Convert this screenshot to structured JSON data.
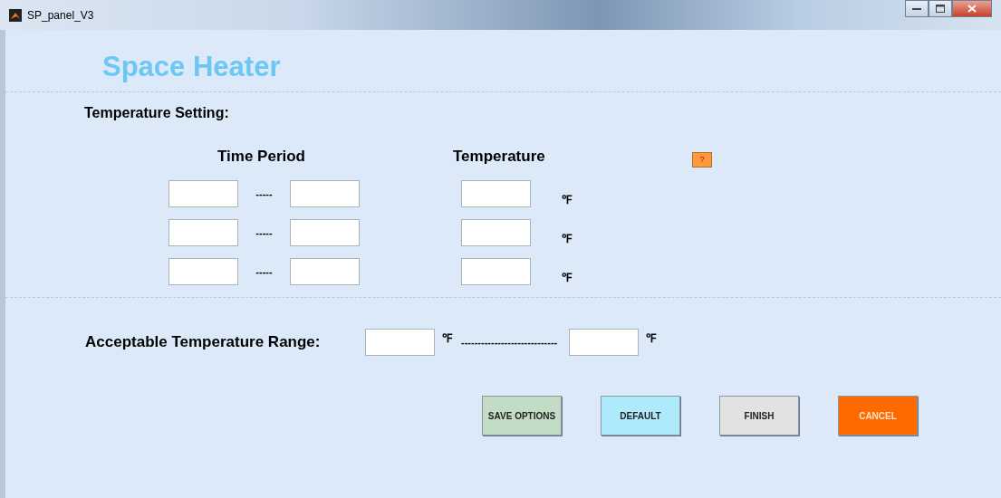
{
  "window": {
    "title": "SP_panel_V3"
  },
  "heading": "Space Heater",
  "temperature_setting": {
    "label": "Temperature Setting:",
    "time_header": "Time Period",
    "temp_header": "Temperature",
    "help": "?",
    "rows": [
      {
        "separator": "-----",
        "unit": "℉"
      },
      {
        "separator": "-----",
        "unit": "℉"
      },
      {
        "separator": "-----",
        "unit": "℉"
      }
    ]
  },
  "range": {
    "label": "Acceptable Temperature Range:",
    "unit_low": "℉",
    "separator": "-----------------------------",
    "unit_high": "℉"
  },
  "buttons": [
    {
      "label": "SAVE OPTIONS",
      "color": "#c3dcc5"
    },
    {
      "label": "DEFAULT",
      "color": "#aeeafc"
    },
    {
      "label": "FINISH",
      "color": "#e2e2e2"
    },
    {
      "label": "CANCEL",
      "color": "#ff6a00"
    }
  ]
}
